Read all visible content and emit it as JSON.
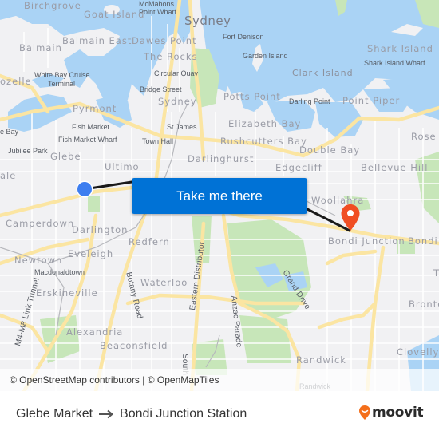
{
  "map": {
    "labels": {
      "birchgrove": "Birchgrove",
      "goat_island": "Goat Island",
      "mcmahons_point_wharf_1": "McMahons",
      "mcmahons_point_wharf_2": "Point Wharf",
      "sydney_city": "Sydney",
      "balmain_east": "Balmain East",
      "dawes_point": "Dawes Point",
      "balmain": "Balmain",
      "the_rocks": "The Rocks",
      "fort_denison": "Fort Denison",
      "garden_island": "Garden Island",
      "shark_island": "Shark Island",
      "shark_island_wharf": "Shark Island Wharf",
      "white_bay_1": "White Bay Cruise",
      "white_bay_2": "Terminal",
      "rozelle": "ozelle",
      "circular_quay": "Circular Quay",
      "clark_island": "Clark Island",
      "bridge_street": "Bridge Street",
      "sydney_station": "Sydney",
      "potts_point": "Potts Point",
      "darling_point": "Darling Point",
      "point_piper": "Point Piper",
      "pyrmont": "Pyrmont",
      "fish_market": "Fish Market",
      "st_james": "St James",
      "elizabeth_bay": "Elizabeth Bay",
      "rose_bay": "Rose Bay",
      "e_bay": "e Bay",
      "fish_market_wharf": "Fish Market Wharf",
      "town_hall": "Town Hall",
      "rushcutters_bay": "Rushcutters Bay",
      "jubilee_park": "Jubilee Park",
      "glebe": "Glebe",
      "double_bay": "Double Bay",
      "darlinghurst": "Darlinghurst",
      "ultimo": "Ultimo",
      "edgecliff": "Edgecliff",
      "bellevue_hill": "Bellevue Hill",
      "ale": "ale",
      "woollahra": "Woollahra",
      "camperdown": "Camperdown",
      "darlington": "Darlington",
      "bondi_junction": "Bondi Junction",
      "bondi": "Bondi",
      "redfern": "Redfern",
      "eveleigh": "Eveleigh",
      "newtown": "Newtown",
      "macdonaldtown": "Macdonaldtown",
      "grand_drive": "Grand Drive",
      "eastern_distributor": "Eastern Distributor",
      "erskineville": "Erskineville",
      "botany_road": "Botany Road",
      "waterloo": "Waterloo",
      "anzac_parade": "Anzac Parade",
      "bronte": "Bronte",
      "m4m8": "M4-M8 Link Tunnel",
      "alexandria": "Alexandria",
      "beaconsfield": "Beaconsfield",
      "clovelly": "Clovelly",
      "southern": "South",
      "randwick_suburb": "Randwick",
      "randwick_station": "Randwick",
      "t_edge": "T"
    },
    "origin_marker": {
      "name": "Glebe Market",
      "color": "#3d7ef0"
    },
    "destination_marker": {
      "name": "Bondi Junction Station",
      "color": "#f04e23"
    },
    "route_line_color": "#1a1a1a",
    "take_me_there_label": "Take me there",
    "attribution": "© OpenStreetMap contributors | © OpenMapTiles"
  },
  "footer": {
    "origin": "Glebe Market",
    "arrow_icon": "arrow-right-icon",
    "destination": "Bondi Junction Station",
    "brand": "moovit",
    "brand_color": "#f46f1b"
  }
}
